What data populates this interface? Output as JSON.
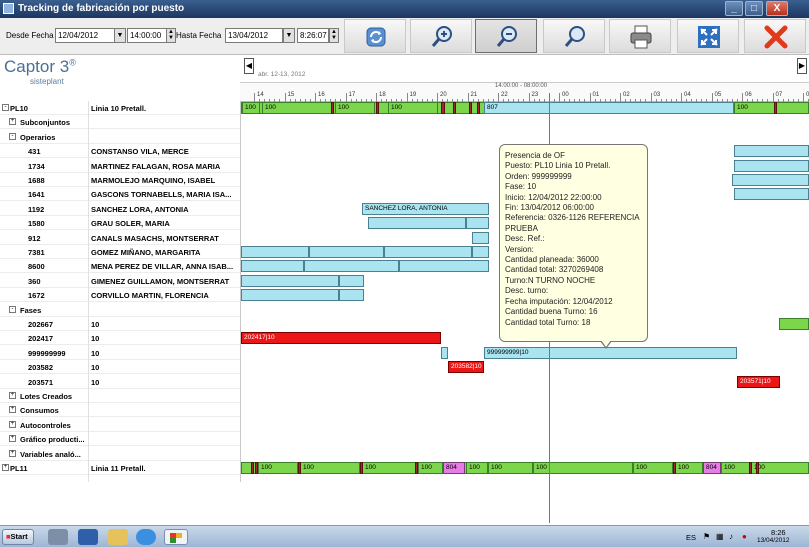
{
  "window": {
    "title": "Tracking de fabricación por puesto",
    "minimize": "_",
    "maximize": "□",
    "close": "X"
  },
  "filters": {
    "desde_label": "Desde Fecha",
    "desde_date": "12/04/2012",
    "desde_time": "14:00:00",
    "hasta_label": "Hasta Fecha",
    "hasta_date": "13/04/2012",
    "hasta_time": "8:26:07"
  },
  "logo": {
    "brand": "Captor 3",
    "reg": "®",
    "sub": "sisteplant"
  },
  "timeline": {
    "date_range": "abr. 12-13, 2012",
    "range_label": "14:00:00 - 08:00:00",
    "ticks": [
      "14",
      "15",
      "16",
      "17",
      "18",
      "19",
      "20",
      "21",
      "22",
      "23",
      "00",
      "01",
      "02",
      "03",
      "04",
      "05",
      "06",
      "07",
      "08"
    ]
  },
  "tree": [
    {
      "code": "PL10",
      "name": "Linia 10 Pretall.",
      "exp": "-",
      "level": 0
    },
    {
      "code": "Subconjuntos",
      "name": "",
      "exp": "+",
      "level": 1
    },
    {
      "code": "Operarios",
      "name": "",
      "exp": "-",
      "level": 1
    },
    {
      "code": "431",
      "name": "CONSTANSO VILA, MERCE",
      "level": 2
    },
    {
      "code": "1734",
      "name": "MARTINEZ FALAGAN, ROSA MARIA",
      "level": 2
    },
    {
      "code": "1688",
      "name": "MARMOLEJO MARQUINO, ISABEL",
      "level": 2
    },
    {
      "code": "1641",
      "name": "GASCONS TORNABELLS, MARIA ISA...",
      "level": 2
    },
    {
      "code": "1192",
      "name": "SANCHEZ LORA, ANTONIA",
      "level": 2
    },
    {
      "code": "1580",
      "name": "GRAU SOLER, MARIA",
      "level": 2
    },
    {
      "code": "912",
      "name": "CANALS MASACHS, MONTSERRAT",
      "level": 2
    },
    {
      "code": "7381",
      "name": "GOMEZ MIÑANO, MARGARITA",
      "level": 2
    },
    {
      "code": "8600",
      "name": "MENA PEREZ DE VILLAR, ANNA ISAB...",
      "level": 2
    },
    {
      "code": "360",
      "name": "GIMENEZ GUILLAMON, MONTSERRAT",
      "level": 2
    },
    {
      "code": "1672",
      "name": "CORVILLO MARTIN, FLORENCIA",
      "level": 2
    },
    {
      "code": "Fases",
      "name": "",
      "exp": "-",
      "level": 1
    },
    {
      "code": "202667",
      "name": "10",
      "level": 2
    },
    {
      "code": "202417",
      "name": "10",
      "level": 2
    },
    {
      "code": "999999999",
      "name": "10",
      "level": 2
    },
    {
      "code": "203582",
      "name": "10",
      "level": 2
    },
    {
      "code": "203571",
      "name": "10",
      "level": 2
    },
    {
      "code": "Lotes Creados",
      "name": "",
      "exp": "+",
      "level": 1
    },
    {
      "code": "Consumos",
      "name": "",
      "exp": "+",
      "level": 1
    },
    {
      "code": "Autocontroles",
      "name": "",
      "exp": "+",
      "level": 1
    },
    {
      "code": "Gráfico producti...",
      "name": "",
      "exp": "+",
      "level": 1
    },
    {
      "code": "Variables analó...",
      "name": "",
      "exp": "+",
      "level": 1
    },
    {
      "code": "PL11",
      "name": "Linia 11 Pretall.",
      "exp": "+",
      "level": 0
    }
  ],
  "bar_labels": {
    "pl10_100": "100",
    "pl10_807": "807",
    "op_1192": "SANCHEZ LORA, ANTONIA",
    "f_202417": "202417|10",
    "f_999": "999999999|10",
    "f_203582": "203582|10",
    "f_203571": "203571|10",
    "pl11_100": "100",
    "pl11_804": "804"
  },
  "tooltip": [
    "Presencia de OF",
    "Puesto: PL10 Linia 10 Pretall.",
    "Orden: 999999999",
    "Fase: 10",
    "Inicio: 12/04/2012 22:00:00",
    "Fin: 13/04/2012 06:00:00",
    "Referencia: 0326-1126  REFERENCIA PRUEBA",
    "Desc. Ref.:",
    "Version:",
    "Cantidad planeada: 36000",
    "Cantidad total: 3270269408",
    "Turno:N TURNO NOCHE",
    "Desc. turno:",
    "Fecha imputación: 12/04/2012",
    "Cantidad buena Turno: 16",
    "Cantidad total Turno: 18"
  ],
  "taskbar": {
    "start": "Start",
    "lang": "ES",
    "time": "8:26",
    "date": "13/04/2012"
  },
  "colors": {
    "run": "#7cd64b",
    "presence": "#a9e4f0",
    "stop": "#ec1616",
    "setup": "#e77ce7",
    "tooltip_bg": "#ffffe1"
  }
}
